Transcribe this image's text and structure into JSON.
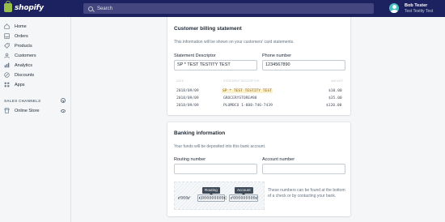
{
  "topbar": {
    "logo_text": "shopify",
    "search_placeholder": "Search",
    "user_name": "Bob Tester",
    "store_name": "Test Testity Test"
  },
  "sidebar": {
    "items": [
      {
        "label": "Home",
        "icon": "home-icon"
      },
      {
        "label": "Orders",
        "icon": "orders-icon"
      },
      {
        "label": "Products",
        "icon": "products-icon"
      },
      {
        "label": "Customers",
        "icon": "customers-icon"
      },
      {
        "label": "Analytics",
        "icon": "analytics-icon"
      },
      {
        "label": "Discounts",
        "icon": "discounts-icon"
      },
      {
        "label": "Apps",
        "icon": "apps-icon"
      }
    ],
    "channels_title": "SALES CHANNELS",
    "online_store": "Online Store"
  },
  "billing": {
    "title": "Customer billing statement",
    "description": "This information will be shown on your customers' card statements.",
    "descriptor_label": "Statement Descriptor",
    "descriptor_value": "SP * TEST TESTITY TEST",
    "phone_label": "Phone number",
    "phone_value": "1234567890",
    "statement_headers": [
      "DATE",
      "STATEMENT DESCRIPTOR",
      "AMOUNT"
    ],
    "statement_rows": [
      {
        "date": "2018/09/09",
        "descriptor": "SP * TEST TESTITY TEST",
        "amount": "$10.00",
        "highlight": true
      },
      {
        "date": "2018/09/09",
        "descriptor": "GROCERYSTORE#88",
        "amount": "$35.00",
        "highlight": false
      },
      {
        "date": "2018/09/09",
        "descriptor": "PLUMBCO 1-888-746-7439",
        "amount": "$120.00",
        "highlight": false
      }
    ]
  },
  "banking": {
    "title": "Banking information",
    "description": "Your funds will be deposited into this bank account.",
    "routing_label": "Routing number",
    "routing_value": "",
    "account_label": "Account number",
    "account_value": "",
    "cheque_routing_tip": "Routing",
    "cheque_account_tip": "Account",
    "cheque_micr_left": "⑈000⑈",
    "cheque_micr_routing": "⑆000000000⑆",
    "cheque_micr_account": "⑈000000000⑈",
    "note": "These numbers can be found at the bottom of a check or by contacting your bank."
  },
  "colors": {
    "topbar": "#1c2260",
    "search": "#43467f",
    "brand_green": "#96bf48",
    "highlight": "#fcf1cd"
  }
}
